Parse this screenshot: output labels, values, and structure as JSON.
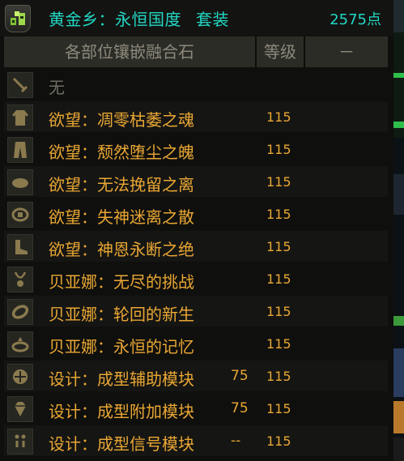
{
  "header": {
    "title": "黄金乡：永恒国度",
    "suit_label": "套装",
    "points": "2575点"
  },
  "columns": {
    "name": "各部位镶嵌融合石",
    "level": "等级",
    "extra": "－"
  },
  "rows": [
    {
      "slot_icon": "weapon-icon",
      "name": "无",
      "sub": "",
      "level": ""
    },
    {
      "slot_icon": "coat-icon",
      "name": "欲望：凋零枯萎之魂",
      "sub": "",
      "level": "115"
    },
    {
      "slot_icon": "pants-icon",
      "name": "欲望：颓然堕尘之魄",
      "sub": "",
      "level": "115"
    },
    {
      "slot_icon": "shoulder-icon",
      "name": "欲望：无法挽留之离",
      "sub": "",
      "level": "115"
    },
    {
      "slot_icon": "belt-icon",
      "name": "欲望：失神迷离之散",
      "sub": "",
      "level": "115"
    },
    {
      "slot_icon": "shoes-icon",
      "name": "欲望：神恩永断之绝",
      "sub": "",
      "level": "115"
    },
    {
      "slot_icon": "necklace-icon",
      "name": "贝亚娜：无尽的挑战",
      "sub": "",
      "level": "115"
    },
    {
      "slot_icon": "bracelet-icon",
      "name": "贝亚娜：轮回的新生",
      "sub": "",
      "level": "115"
    },
    {
      "slot_icon": "ring-icon",
      "name": "贝亚娜：永恒的记忆",
      "sub": "",
      "level": "115"
    },
    {
      "slot_icon": "support-icon",
      "name": "设计：成型辅助模块",
      "sub": "75",
      "level": "115"
    },
    {
      "slot_icon": "magic-stone-icon",
      "name": "设计：成型附加模块",
      "sub": "75",
      "level": "115"
    },
    {
      "slot_icon": "earring-icon",
      "name": "设计：成型信号模块",
      "sub": "--",
      "level": "115"
    }
  ],
  "colors": {
    "title": "#22d8c4",
    "item_name": "#e9a734",
    "empty": "#6e6c62",
    "header_bg": "#2c2c27"
  }
}
